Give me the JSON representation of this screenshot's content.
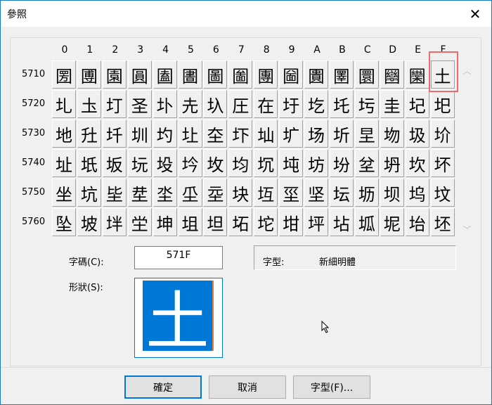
{
  "window": {
    "title": "參照",
    "close_icon": "close-icon"
  },
  "grid": {
    "columns": [
      "0",
      "1",
      "2",
      "3",
      "4",
      "5",
      "6",
      "7",
      "8",
      "9",
      "A",
      "B",
      "C",
      "D",
      "E",
      "F"
    ],
    "rows": [
      {
        "label": "5710",
        "chars": [
          "圐",
          "圑",
          "園",
          "圓",
          "圔",
          "圕",
          "圖",
          "圗",
          "團",
          "圙",
          "圚",
          "圛",
          "圜",
          "圝",
          "圞",
          "土"
        ]
      },
      {
        "label": "5720",
        "chars": [
          "圠",
          "圡",
          "圢",
          "圣",
          "圤",
          "圥",
          "圦",
          "圧",
          "在",
          "圩",
          "圪",
          "圫",
          "圬",
          "圭",
          "圮",
          "圯"
        ]
      },
      {
        "label": "5730",
        "chars": [
          "地",
          "圱",
          "圲",
          "圳",
          "圴",
          "圵",
          "圶",
          "圷",
          "圸",
          "圹",
          "场",
          "圻",
          "圼",
          "圽",
          "圾",
          "圿"
        ]
      },
      {
        "label": "5740",
        "chars": [
          "址",
          "坁",
          "坂",
          "坃",
          "坄",
          "坅",
          "坆",
          "均",
          "坈",
          "坉",
          "坊",
          "坋",
          "坌",
          "坍",
          "坎",
          "坏"
        ]
      },
      {
        "label": "5750",
        "chars": [
          "坐",
          "坑",
          "坒",
          "坓",
          "坔",
          "坕",
          "坖",
          "块",
          "坘",
          "坙",
          "坚",
          "坛",
          "坜",
          "坝",
          "坞",
          "坟"
        ]
      },
      {
        "label": "5760",
        "chars": [
          "坠",
          "坡",
          "坢",
          "坣",
          "坤",
          "坥",
          "坦",
          "坧",
          "坨",
          "坩",
          "坪",
          "坫",
          "坬",
          "坭",
          "坮",
          "坯"
        ]
      }
    ],
    "selected": {
      "row": 0,
      "col": 15
    }
  },
  "code": {
    "label": "字碼(C):",
    "value": "571F"
  },
  "font": {
    "label": "字型:",
    "value": "新細明體"
  },
  "shape": {
    "label": "形狀(S):",
    "char": "土"
  },
  "buttons": {
    "ok": "確定",
    "cancel": "取消",
    "font": "字型(F)..."
  },
  "colors": {
    "accent": "#0078d7",
    "selection_ring": "#ef6a6a"
  }
}
